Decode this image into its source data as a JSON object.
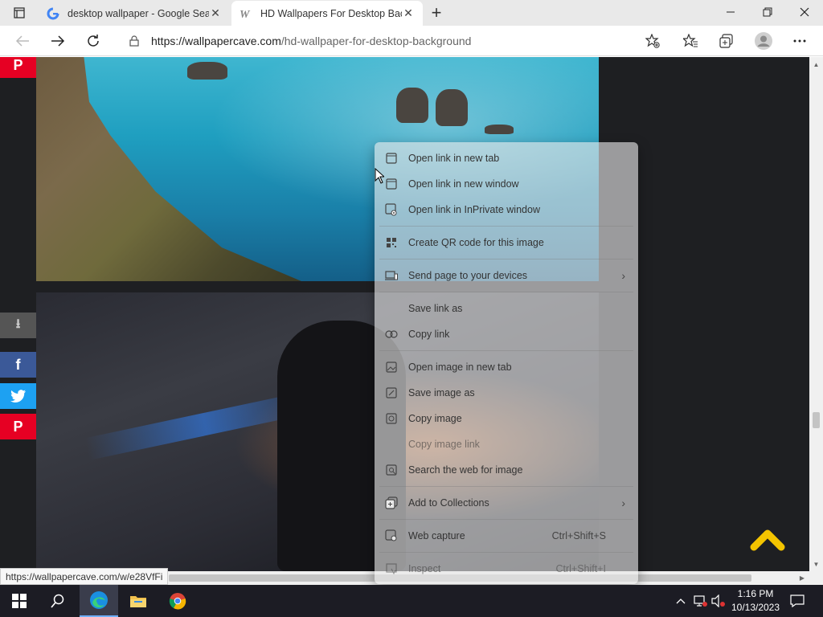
{
  "browser": {
    "tabs": [
      {
        "title": "desktop wallpaper - Google Sea",
        "favicon": "google-icon",
        "active": false
      },
      {
        "title": "HD Wallpapers For Desktop Back",
        "favicon": "wallpapercave-icon",
        "active": true
      }
    ],
    "address": {
      "host": "https://wallpapercave.com",
      "path": "/hd-wallpaper-for-desktop-background"
    },
    "status_url": "https://wallpapercave.com/w/e28VfFi"
  },
  "page": {
    "social": [
      "pinterest-icon",
      "download-icon",
      "facebook-icon",
      "twitter-icon",
      "pinterest-icon"
    ]
  },
  "context_menu": {
    "items": [
      {
        "label": "Open link in new tab",
        "icon": "new-tab-icon"
      },
      {
        "label": "Open link in new window",
        "icon": "new-window-icon"
      },
      {
        "label": "Open link in InPrivate window",
        "icon": "inprivate-icon"
      },
      {
        "label": "Create QR code for this image",
        "icon": "qr-code-icon"
      },
      {
        "label": "Send page to your devices",
        "icon": "devices-icon"
      },
      {
        "label": "Save link as",
        "icon": ""
      },
      {
        "label": "Copy link",
        "icon": "link-icon"
      },
      {
        "label": "Open image in new tab",
        "icon": "image-tab-icon"
      },
      {
        "label": "Save image as",
        "icon": "save-image-icon"
      },
      {
        "label": "Copy image",
        "icon": "copy-image-icon"
      },
      {
        "label": "Copy image link",
        "icon": ""
      },
      {
        "label": "Search the web for image",
        "icon": "search-image-icon"
      },
      {
        "label": "Add to Collections",
        "icon": "collections-icon"
      },
      {
        "label": "Web capture",
        "icon": "web-capture-icon",
        "shortcut": "Ctrl+Shift+S"
      },
      {
        "label": "Inspect",
        "icon": "inspect-icon",
        "shortcut": "Ctrl+Shift+I"
      }
    ]
  },
  "taskbar": {
    "time": "1:16 PM",
    "date": "10/13/2023"
  },
  "colors": {
    "pinterest": "#e60023",
    "facebook": "#3b5998",
    "twitter": "#1da1f2",
    "scroll_top_arrow": "#f4c400"
  }
}
